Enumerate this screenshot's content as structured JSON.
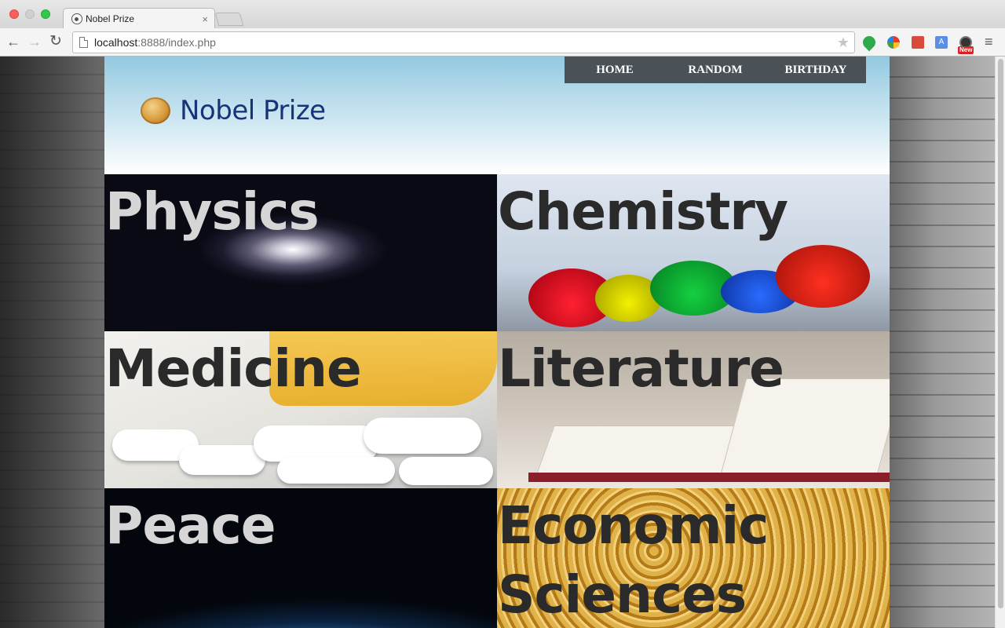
{
  "browser": {
    "tab_title": "Nobel Prize",
    "url_host": "localhost",
    "url_rest": ":8888/index.php",
    "extension_badge": "New"
  },
  "site": {
    "title": "Nobel Prize",
    "nav": [
      "HOME",
      "RANDOM",
      "BIRTHDAY"
    ]
  },
  "categories": [
    {
      "label": "Physics"
    },
    {
      "label": "Chemistry"
    },
    {
      "label": "Medicine"
    },
    {
      "label": "Literature"
    },
    {
      "label": "Peace"
    },
    {
      "label": "Economic Sciences"
    }
  ],
  "icons": {
    "back": "arrow-left-icon",
    "forward": "arrow-right-icon",
    "reload": "reload-icon",
    "bookmark": "star-icon",
    "menu": "hamburger-icon",
    "logo": "nobel-medal-icon"
  }
}
